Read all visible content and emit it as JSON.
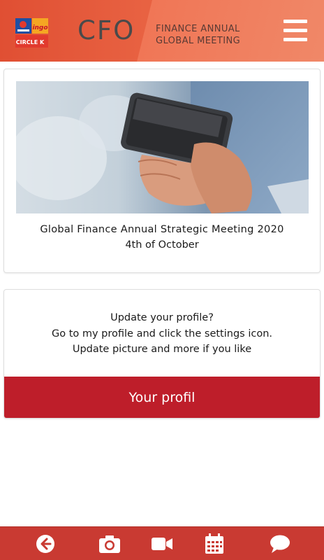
{
  "header": {
    "app_name": "CFO",
    "tagline_line1": "FINANCE ANNUAL",
    "tagline_line2": "GLOBAL MEETING",
    "logo_texts": [
      "ingo",
      "CIRCLE K"
    ],
    "menu_icon": "hamburger-menu-icon"
  },
  "event_card": {
    "image_desc_icon": "phone-in-hands-photo",
    "title": "Global Finance Annual Strategic Meeting 2020",
    "date": "4th of October"
  },
  "profile_card": {
    "heading": "Update your profile?",
    "line1": "Go to my profile and click the settings icon.",
    "line2": "Update picture and more if you like",
    "button_label": "Your profil"
  },
  "bottom_nav": {
    "items": [
      {
        "icon": "back-arrow-icon"
      },
      {
        "icon": "camera-icon"
      },
      {
        "icon": "video-camera-icon"
      },
      {
        "icon": "calendar-icon"
      },
      {
        "icon": "chat-bubble-icon"
      }
    ]
  },
  "colors": {
    "header_start": "#e04f33",
    "header_end": "#ec6a48",
    "button_red": "#be1e2a",
    "nav_red": "#c93a32"
  }
}
